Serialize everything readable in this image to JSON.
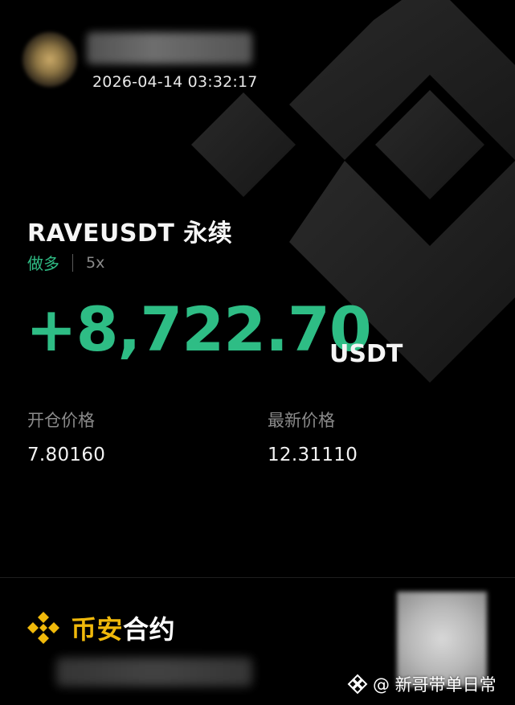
{
  "header": {
    "timestamp": "2026-04-14 03:32:17"
  },
  "position": {
    "symbol": "RAVEUSDT 永续",
    "side": "做多",
    "leverage": "5x",
    "pnl": "+8,722.70",
    "pnl_unit": "USDT",
    "entry_price_label": "开仓价格",
    "entry_price": "7.80160",
    "mark_price_label": "最新价格",
    "mark_price": "12.31110"
  },
  "brand": {
    "name_gold": "币安",
    "name_white": "合约",
    "icon": "binance-logo-icon"
  },
  "watermark": {
    "text": "@ 新哥带单日常",
    "icon": "diamond-logo-icon"
  },
  "colors": {
    "profit_green": "#2ebd85",
    "brand_gold": "#f0b90b",
    "background": "#000000",
    "muted_text": "#8a8a8a"
  }
}
